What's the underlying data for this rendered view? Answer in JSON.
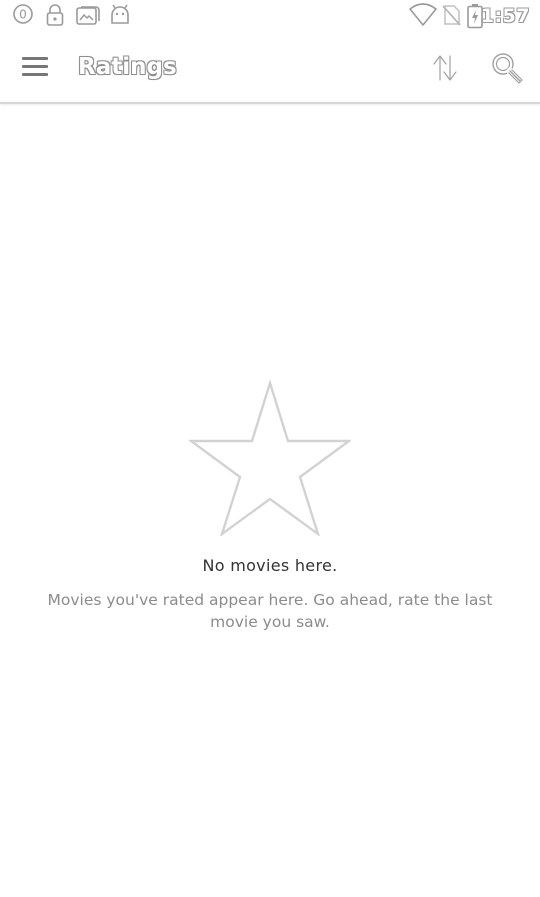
{
  "status_bar": {
    "time": "1:57",
    "icons": [
      "notification-circle-icon",
      "lock-icon",
      "photo-icon",
      "android-icon",
      "wifi-icon",
      "no-sim-icon",
      "battery-charging-icon"
    ]
  },
  "app_bar": {
    "title": "Ratings",
    "menu_icon": "hamburger-menu-icon",
    "sort_icon": "sort-arrows-icon",
    "search_icon": "search-icon"
  },
  "empty_state": {
    "icon": "star-outline-icon",
    "title": "No movies here.",
    "message": "Movies you've rated appear here. Go ahead, rate the last movie you saw."
  }
}
